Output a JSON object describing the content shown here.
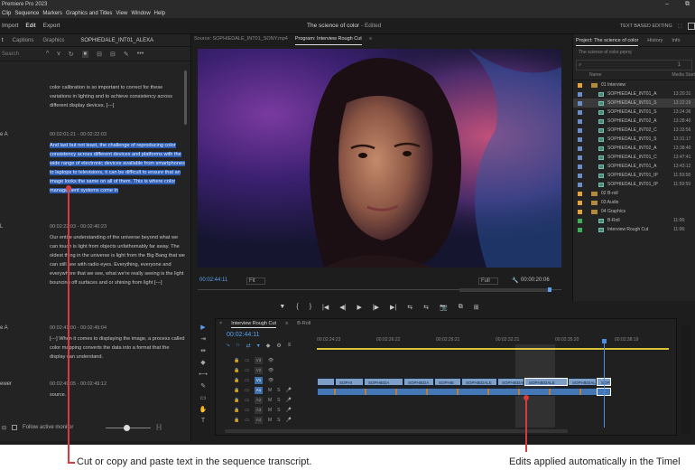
{
  "app": {
    "title": "Premiere Pro 2023",
    "window_controls": [
      "–",
      "⧉"
    ]
  },
  "menu": [
    "Clip",
    "Sequence",
    "Markers",
    "Graphics and Titles",
    "View",
    "Window",
    "Help"
  ],
  "workspace": {
    "tabs": [
      "Import",
      "Edit",
      "Export"
    ],
    "active_tab": "Edit",
    "doc_title": "The science of color",
    "doc_status": " - Edited",
    "right_label": "TEXT BASED EDITING",
    "right_glyph": "⬚"
  },
  "text_panel": {
    "tabs": [
      "t",
      "Captions",
      "Graphics"
    ],
    "active_tab": "t",
    "clip_name": "SOPHIEDALE_INT01_ALEXA",
    "search_placeholder": "Search",
    "tools": [
      "^",
      "v",
      "↻",
      "⏸",
      "⊟",
      "⊟",
      "✎",
      "•••"
    ],
    "blocks": [
      {
        "speaker": "",
        "time": "",
        "text": "color calibration is so important to correct for these variations in lighting and to achieve consistency across different display devices. [---]"
      },
      {
        "speaker": "e A",
        "time": "00:02:01:21 - 00:02:22:03",
        "text": "And last but not least, the challenge of reproducing color consistency across different devices and platforms with the wide range of electronic devices available from smartphones to laptops to televisions, it can be difficult to ensure that an image looks the same on all of them. This is where color management systems come in"
      },
      {
        "speaker": "L",
        "time": "00:02:22:03 - 00:02:40:23",
        "text": "Our entire understanding of the universe beyond what we can touch is light from objects unfathomably far away. The oldest thing in the universe is light from the Big Bang that we can still see with radio eyes. Everything, everyone and everywhere that we see, what we're really seeing is the light bouncing off surfaces and or shining from light [---]"
      },
      {
        "speaker": "e A",
        "time": "00:02:41:00 - 00:02:49:04",
        "text": "[---] When it comes to displaying the image, a process called color mapping converts the data into a format that the display can understand."
      },
      {
        "speaker": "ewer",
        "time": "00:02:49:05 - 00:02:49:12",
        "text": "source."
      }
    ],
    "footer": {
      "follow_label": "Follow active monitor",
      "left_glyph": "⊟",
      "right_glyph": "[-]"
    }
  },
  "monitors": {
    "source_tab": "Source: SOPHIEDALE_INT01_SONY.mp4",
    "program_tab": "Program: Interview Rough Cut",
    "program_menu_glyph": "≡",
    "current_tc": "00:02:44:11",
    "fit_label": "Fit",
    "quality_label": "Full",
    "duration_tc": "00:00:20:06",
    "transport_glyphs": [
      "▼",
      "{",
      "}",
      "|◀",
      "◀|",
      "▶",
      "|▶",
      "▶|",
      "⇆",
      "⇆",
      "📷",
      "⧉",
      "⊞"
    ]
  },
  "project": {
    "tabs": [
      "Project: The science of color",
      "History",
      "Info"
    ],
    "active_tab": "Project: The science of color",
    "menu_glyph": "≡",
    "file_name": "The science of color.prproj",
    "search_glyph": "⌕",
    "count_label": "1",
    "columns": [
      "Name",
      "Media Start"
    ],
    "rows": [
      {
        "kind": "folder",
        "name": "01 Interview",
        "date": "",
        "color": "#e3a23a"
      },
      {
        "kind": "file",
        "name": "SOPHIEDALE_INT01_A",
        "date": "13:20:31",
        "color": "#6c8cc8"
      },
      {
        "kind": "file",
        "name": "SOPHIEDALE_INT01_S",
        "date": "13:22:29",
        "color": "#6c8cc8",
        "selected": true
      },
      {
        "kind": "file",
        "name": "SOPHIEDALE_INT01_S",
        "date": "13:24:36",
        "color": "#6c8cc8"
      },
      {
        "kind": "file",
        "name": "SOPHIEDALE_INT02_A",
        "date": "13:28:40",
        "color": "#6c8cc8"
      },
      {
        "kind": "file",
        "name": "SOPHIEDALE_INT02_C",
        "date": "13:33:56",
        "color": "#6c8cc8"
      },
      {
        "kind": "file",
        "name": "SOPHIEDALE_INT01_S",
        "date": "13:31:17",
        "color": "#6c8cc8"
      },
      {
        "kind": "file",
        "name": "SOPHIEDALE_INT02_A",
        "date": "13:38:40",
        "color": "#6c8cc8"
      },
      {
        "kind": "file",
        "name": "SOPHIEDALE_INT01_C",
        "date": "13:47:41",
        "color": "#6c8cc8"
      },
      {
        "kind": "file",
        "name": "SOPHIEDALE_INT01_A",
        "date": "13:43:12",
        "color": "#6c8cc8"
      },
      {
        "kind": "file",
        "name": "SOPHIEDALE_INT01_IP",
        "date": "11:59:58",
        "color": "#6c8cc8"
      },
      {
        "kind": "file",
        "name": "SOPHIEDALE_INT01_IP",
        "date": "11:59:59",
        "color": "#6c8cc8"
      },
      {
        "kind": "folder",
        "name": "02 B-roll",
        "date": "",
        "color": "#e3a23a"
      },
      {
        "kind": "folder",
        "name": "03 Audio",
        "date": "",
        "color": "#e3a23a"
      },
      {
        "kind": "folder",
        "name": "04 Graphics",
        "date": "",
        "color": "#e3a23a"
      },
      {
        "kind": "seq",
        "name": "B-Roll",
        "date": "11:06:",
        "color": "#3fae5b"
      },
      {
        "kind": "seq",
        "name": "Interview Rough Cut",
        "date": "11:06:",
        "color": "#3fae5b"
      }
    ]
  },
  "tools": [
    "▶",
    "⇥",
    "⇹",
    "◆",
    "⟷",
    "✎",
    "▭",
    "✋",
    "T"
  ],
  "timeline": {
    "tabs": [
      "Interview Rough Cut",
      "B-Roll"
    ],
    "active_tab": "Interview Rough Cut",
    "close_glyph": "×",
    "menu_glyph": "≡",
    "timecode": "00:02:44:11",
    "ruler_labels": [
      "00:02:24:23",
      "00:02:26:22",
      "00:02:29:21",
      "00:02:32:21",
      "00:02:35:20",
      "00:02:38:19"
    ],
    "tracks": [
      {
        "name": "V3",
        "glyphs": [
          "🔒",
          "▭",
          "👁"
        ]
      },
      {
        "name": "V2",
        "glyphs": [
          "🔒",
          "▭",
          "👁"
        ]
      },
      {
        "name": "V1",
        "glyphs": [
          "🔒",
          "▭",
          "👁"
        ]
      },
      {
        "name": "A1",
        "glyphs": [
          "🔒",
          "▭",
          "M",
          "S",
          "🎤"
        ]
      },
      {
        "name": "A2",
        "glyphs": [
          "🔒",
          "▭",
          "M",
          "S",
          "🎤"
        ]
      },
      {
        "name": "A3",
        "glyphs": [
          "🔒",
          "▭",
          "M",
          "S",
          "🎤"
        ]
      },
      {
        "name": "A4",
        "glyphs": [
          "🔒",
          "▭",
          "M",
          "S",
          "🎤"
        ]
      }
    ],
    "video_clips": [
      "SOPHI",
      "SOPHIEDA",
      "SOPHIEDA",
      "SOPHIE",
      "SOPHIEDALE",
      "SOPHIEDALE",
      "SOPHIEDALE",
      "SOPHIEDAL",
      "SOPHIEDAL"
    ],
    "timeline_tool_glyphs": [
      "⤷",
      "∩",
      "⇄",
      "▾",
      "◆",
      "⚙",
      "≡"
    ]
  },
  "captions": {
    "left": "Cut or copy and paste text in the sequence transcript.",
    "right": "Edits applied automatically in the Timel"
  },
  "colors": {
    "highlight": "#2d5db3",
    "accent_blue": "#5aa0f0",
    "annotation_red": "#d93a3a"
  }
}
